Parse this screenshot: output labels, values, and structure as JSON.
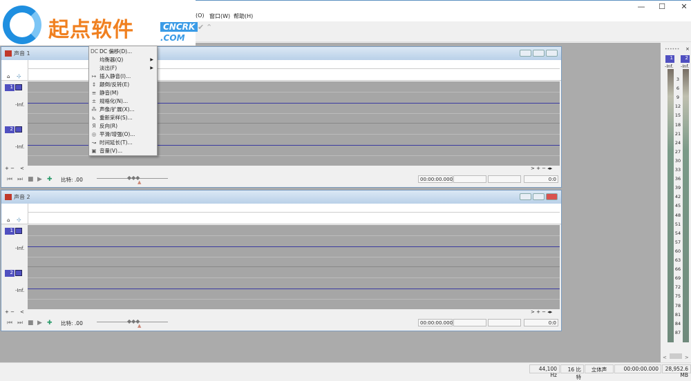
{
  "window": {
    "minimize": "—",
    "maximize": "☐",
    "close": "✕"
  },
  "menubar": {
    "items": [
      "(O)",
      "窗口(W)",
      "帮助(H)"
    ]
  },
  "logo": {
    "brand": "起点软件",
    "tag": "CNCRK",
    ".com": ".COM"
  },
  "docs": [
    {
      "title": "声音 1",
      "ratio_label": "比特: .00",
      "time": "00:00:00.000",
      "pos": "0:0",
      "channels": [
        "1",
        "2"
      ],
      "inf": "-Inf."
    },
    {
      "title": "声音 2",
      "ratio_label": "比特: .00",
      "time": "00:00:00.000",
      "pos": "0:0",
      "channels": [
        "1",
        "2"
      ],
      "inf": "-Inf."
    }
  ],
  "menu": {
    "items": [
      {
        "icon": "DC",
        "label": "DC 偏移(D)..."
      },
      {
        "icon": "",
        "label": "均衡器(Q)",
        "sub": "▶"
      },
      {
        "icon": "",
        "label": "淡出(F)",
        "sub": "▶"
      },
      {
        "icon": "↦",
        "label": "插入静音(I)..."
      },
      {
        "icon": "↕",
        "label": "颠倒/反转(E)"
      },
      {
        "icon": "≡",
        "label": "静音(M)"
      },
      {
        "icon": "±",
        "label": "规格化(N)..."
      },
      {
        "icon": "⁂",
        "label": "声像/扩展(X)..."
      },
      {
        "icon": "⊾",
        "label": "重新采样(S)..."
      },
      {
        "icon": "Я",
        "label": "反向(R)"
      },
      {
        "icon": "◎",
        "label": "平滑/增强(O)..."
      },
      {
        "icon": "↝",
        "label": "时间延长(T)..."
      },
      {
        "icon": "▣",
        "label": "音量(V)..."
      }
    ]
  },
  "meter": {
    "channels": [
      "1",
      "2"
    ],
    "top": "-Inf.",
    "ticks": [
      "3",
      "6",
      "9",
      "12",
      "15",
      "18",
      "21",
      "24",
      "27",
      "30",
      "33",
      "36",
      "39",
      "42",
      "45",
      "48",
      "51",
      "54",
      "57",
      "60",
      "63",
      "66",
      "69",
      "72",
      "75",
      "78",
      "81",
      "84",
      "87"
    ]
  },
  "status": {
    "rate": "44,100 Hz",
    "bits": "16 比特",
    "channels": "立体声",
    "time": "00:00:00.000",
    "free": "28,952.6 MB"
  }
}
